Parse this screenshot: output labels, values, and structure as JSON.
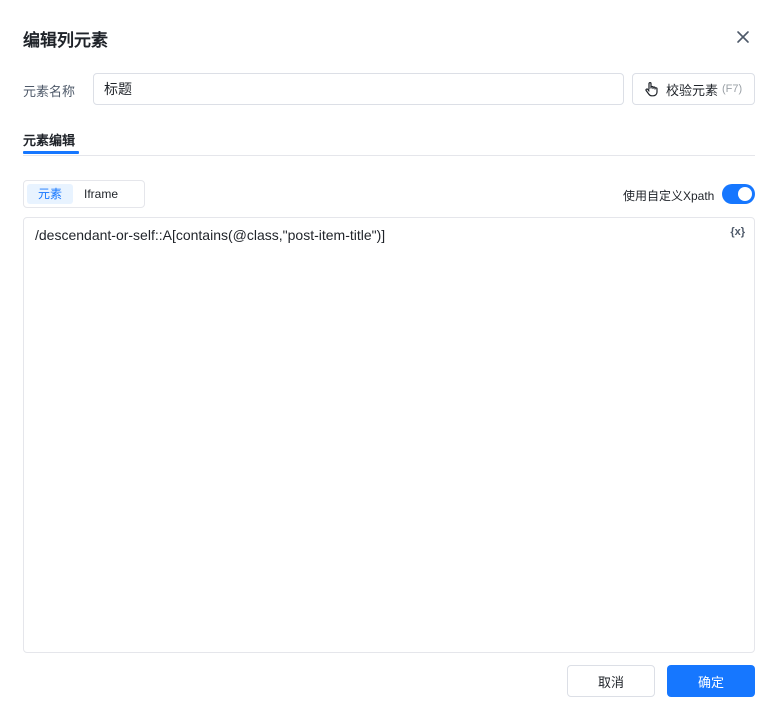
{
  "dialog": {
    "title": "编辑列元素",
    "close_icon": "close-icon"
  },
  "name_field": {
    "label": "元素名称",
    "value": "标题"
  },
  "verify_button": {
    "icon": "pointer-hand-icon",
    "label": "校验元素",
    "shortcut": "(F7)"
  },
  "tabs": [
    {
      "label": "元素编辑",
      "active": true
    }
  ],
  "mode_switch": {
    "items": [
      "元素",
      "Iframe"
    ],
    "selected": "元素"
  },
  "xpath_toggle": {
    "label": "使用自定义Xpath",
    "on": true,
    "color": "#1677ff"
  },
  "editor": {
    "content": "/descendant-or-self::A[contains(@class,\"post-item-title\")]",
    "variable_icon": "{x}"
  },
  "footer": {
    "cancel_label": "取消",
    "ok_label": "确定"
  },
  "colors": {
    "accent": "#1677ff"
  }
}
